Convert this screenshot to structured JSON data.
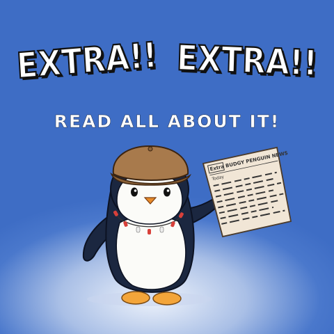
{
  "headline": {
    "word1": "EXTRA!!",
    "word2": "EXTRA!!"
  },
  "subheadline": "READ ALL ABOUT IT!",
  "newspaper": {
    "masthead_box": "Extra",
    "masthead": "BUDGY PENGUIN NEWS",
    "date_label": "Today"
  },
  "colors": {
    "background": "#3f6fc6",
    "hat": "#a87a4c",
    "penguin_body": "#1b2740",
    "paper": "#f1e6d6",
    "feet": "#f3a53a"
  }
}
